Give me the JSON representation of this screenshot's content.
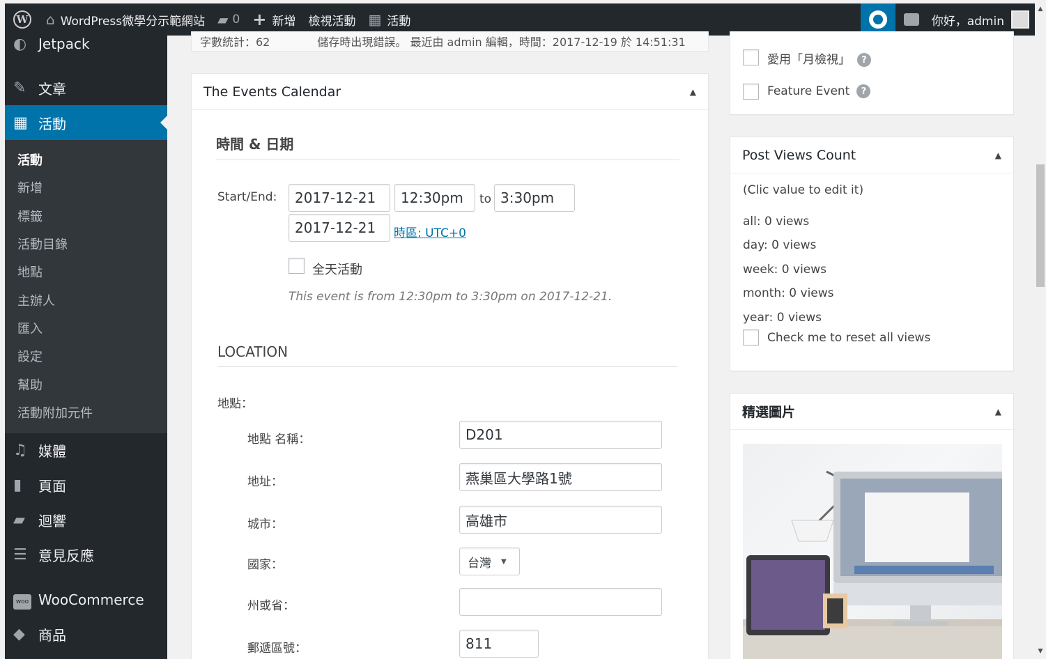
{
  "adminbar": {
    "site_name": "WordPress微學分示範網站",
    "comments_count": "0",
    "new_label": "新增",
    "view_event_label": "檢視活動",
    "events_label": "活動",
    "greeting": "你好，admin"
  },
  "sidebar": {
    "items": [
      {
        "label": "Jetpack",
        "icon": "jetpack-icon"
      },
      {
        "label": "文章",
        "icon": "pin-icon"
      },
      {
        "label": "活動",
        "icon": "calendar-icon"
      },
      {
        "label": "媒體",
        "icon": "media-icon"
      },
      {
        "label": "頁面",
        "icon": "page-icon"
      },
      {
        "label": "迴響",
        "icon": "comment-icon"
      },
      {
        "label": "意見反應",
        "icon": "feedback-icon"
      },
      {
        "label": "WooCommerce",
        "icon": "woo-icon"
      },
      {
        "label": "商品",
        "icon": "product-icon"
      }
    ],
    "submenu": [
      "活動",
      "新增",
      "標籤",
      "活動目錄",
      "地點",
      "主辦人",
      "匯入",
      "設定",
      "幫助",
      "活動附加元件"
    ]
  },
  "status": {
    "word_count": "字數統計：62",
    "last_edit": "儲存時出現錯誤。 最近由 admin 編輯，時間：2017-12-19 於 14:51:31"
  },
  "events_calendar": {
    "title": "The Events Calendar",
    "datetime_heading": "時間 & 日期",
    "start_end_label": "Start/End:",
    "start_date": "2017-12-21",
    "start_time": "12:30pm",
    "to_label": "to",
    "end_time": "3:30pm",
    "end_date": "2017-12-21",
    "timezone_link": "時區: UTC+0",
    "all_day_label": "全天活動",
    "summary": "This event is from 12:30pm to 3:30pm on 2017-12-21.",
    "location_heading": "LOCATION",
    "venue_label": "地點：",
    "venue_name_label": "地點 名稱：",
    "venue_name": "D201",
    "address_label": "地址：",
    "address": "燕巢區大學路1號",
    "city_label": "城市：",
    "city": "高雄市",
    "country_label": "國家：",
    "country": "台灣",
    "province_label": "州或省：",
    "province": "",
    "postal_label": "郵遞區號：",
    "postal": "811"
  },
  "options_box": {
    "favorite_label": "愛用「月檢視」",
    "feature_label": "Feature Event"
  },
  "post_views": {
    "title": "Post Views Count",
    "hint": "(Clic value to edit it)",
    "all": "all: 0 views",
    "day": "day: 0 views",
    "week": "week: 0 views",
    "month": "month: 0 views",
    "year": "year: 0 views",
    "reset_label": "Check me to reset all views"
  },
  "featured_image": {
    "title": "精選圖片"
  },
  "colors": {
    "admin_dark": "#23282d",
    "accent": "#0073aa"
  }
}
